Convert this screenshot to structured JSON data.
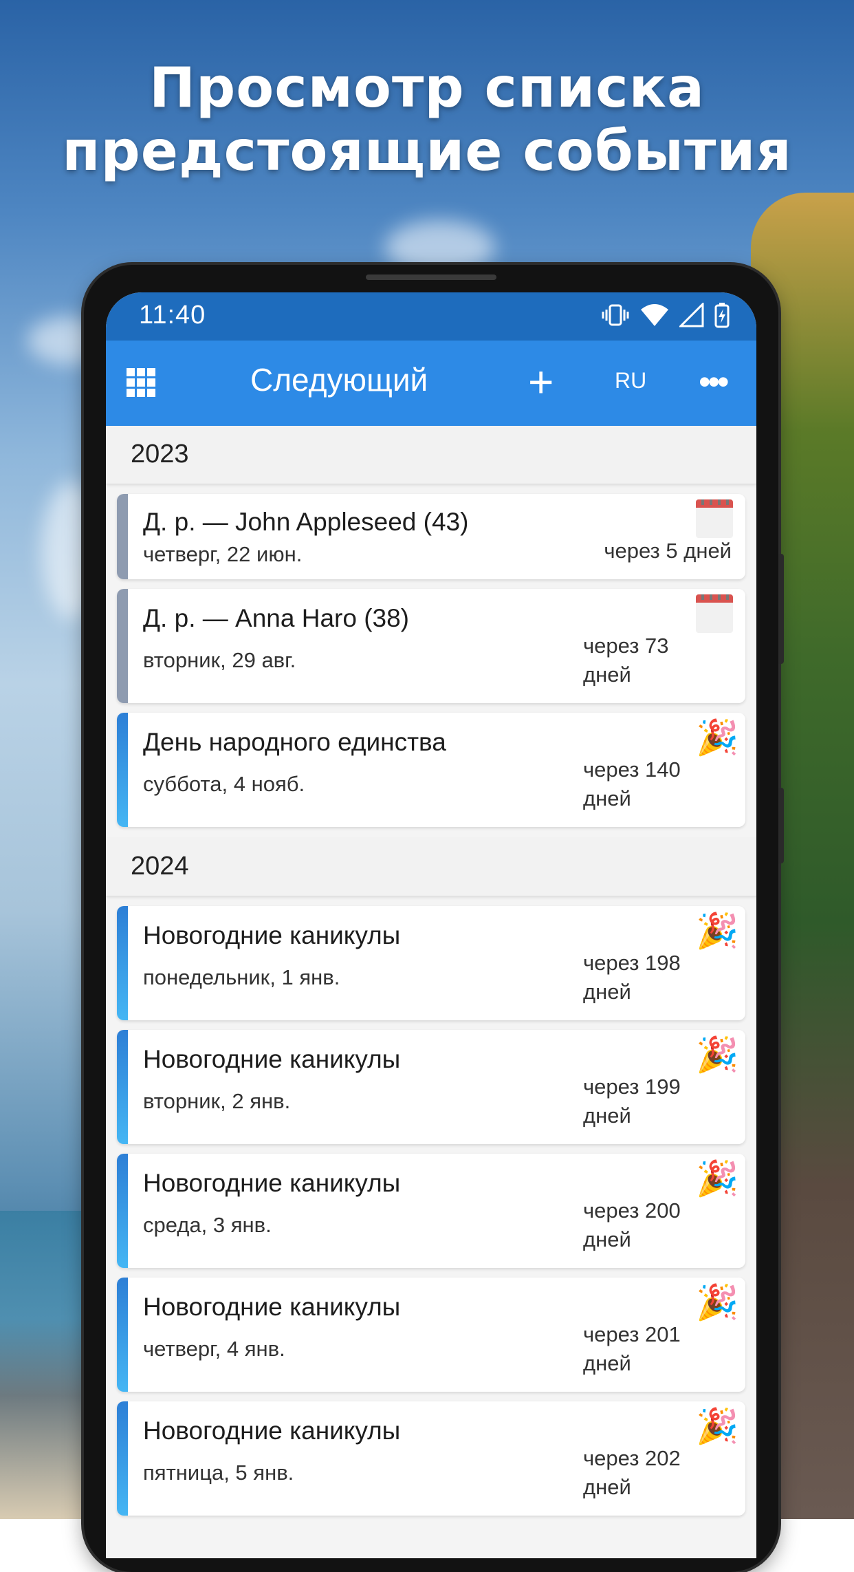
{
  "headline": {
    "line1": "Просмотр списка",
    "line2": "предстоящие события"
  },
  "status_bar": {
    "time": "11:40"
  },
  "app_bar": {
    "title": "Следующий",
    "add_label": "+",
    "language": "RU",
    "more_label": "•••"
  },
  "colors": {
    "app_bar": "#2d8ae6",
    "status_bar": "#1e6cbd",
    "birthday_bar": "#8e9bb0",
    "holiday_bar": "#2d7fd6"
  },
  "sections": [
    {
      "year": "2023",
      "events": [
        {
          "title": "Д. р. — John Appleseed (43)",
          "date": "четверг, 22 июн.",
          "countdown": "через 5 дней",
          "countdown_line1": "",
          "countdown_line2": "",
          "icon": "calendar-icon",
          "kind": "birthday"
        },
        {
          "title": "Д. р. — Anna Haro (38)",
          "date": "вторник, 29 авг.",
          "countdown": "",
          "countdown_line1": "через 73",
          "countdown_line2": "дней",
          "icon": "calendar-icon",
          "kind": "birthday"
        },
        {
          "title": "День народного единства",
          "date": "суббота, 4 нояб.",
          "countdown": "",
          "countdown_line1": "через 140",
          "countdown_line2": "дней",
          "icon": "party-popper-icon",
          "kind": "holiday"
        }
      ]
    },
    {
      "year": "2024",
      "events": [
        {
          "title": "Новогодние каникулы",
          "date": "понедельник, 1 янв.",
          "countdown": "",
          "countdown_line1": "через 198",
          "countdown_line2": "дней",
          "icon": "party-popper-icon",
          "kind": "holiday"
        },
        {
          "title": "Новогодние каникулы",
          "date": "вторник, 2 янв.",
          "countdown": "",
          "countdown_line1": "через 199",
          "countdown_line2": "дней",
          "icon": "party-popper-icon",
          "kind": "holiday"
        },
        {
          "title": "Новогодние каникулы",
          "date": "среда, 3 янв.",
          "countdown": "",
          "countdown_line1": "через 200",
          "countdown_line2": "дней",
          "icon": "party-popper-icon",
          "kind": "holiday"
        },
        {
          "title": "Новогодние каникулы",
          "date": "четверг, 4 янв.",
          "countdown": "",
          "countdown_line1": "через 201",
          "countdown_line2": "дней",
          "icon": "party-popper-icon",
          "kind": "holiday"
        },
        {
          "title": "Новогодние каникулы",
          "date": "пятница, 5 янв.",
          "countdown": "",
          "countdown_line1": "через 202",
          "countdown_line2": "дней",
          "icon": "party-popper-icon",
          "kind": "holiday"
        }
      ]
    }
  ]
}
